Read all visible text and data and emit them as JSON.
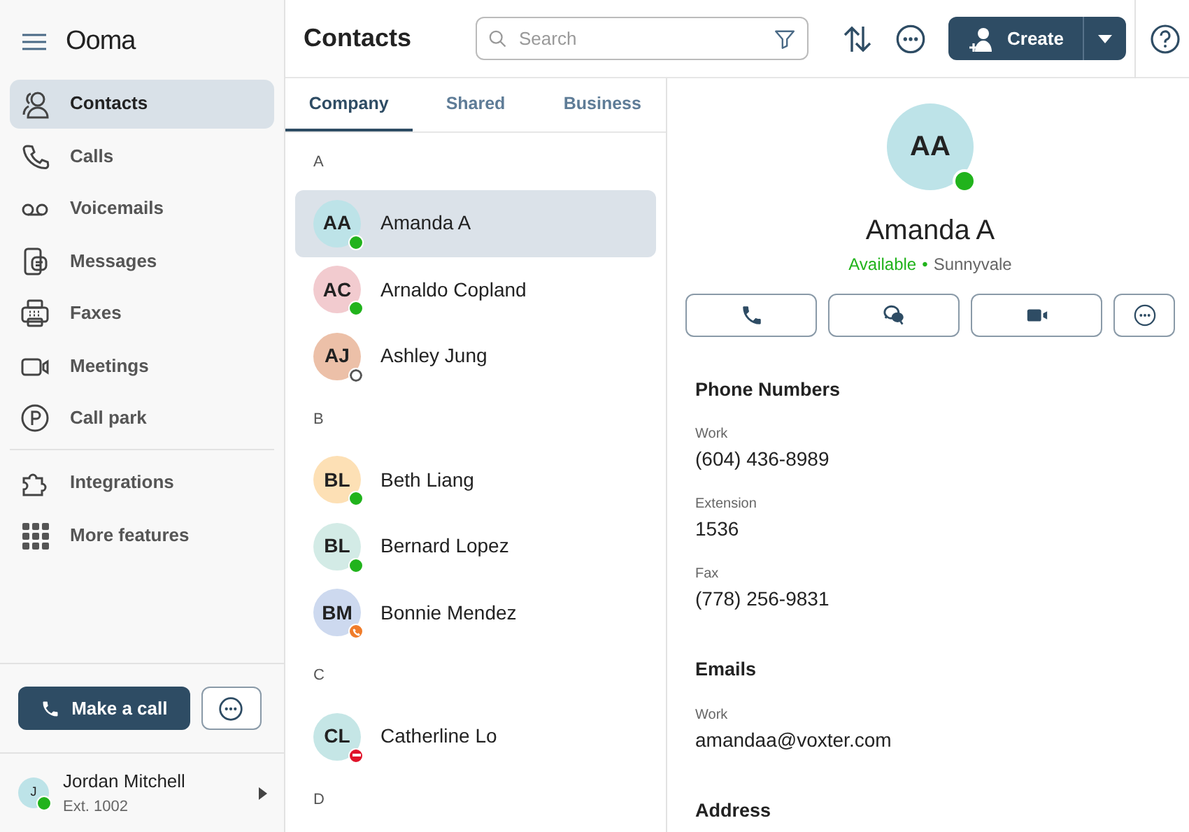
{
  "app": {
    "name": "Ooma"
  },
  "nav": [
    {
      "label": "Contacts",
      "kind": "contacts",
      "selected": true
    },
    {
      "label": "Calls",
      "kind": "phone",
      "selected": false
    },
    {
      "label": "Voicemails",
      "kind": "voicemail",
      "selected": false
    },
    {
      "label": "Messages",
      "kind": "messages",
      "selected": false
    },
    {
      "label": "Faxes",
      "kind": "fax",
      "selected": false
    },
    {
      "label": "Meetings",
      "kind": "video",
      "selected": false
    },
    {
      "label": "Call park",
      "kind": "park",
      "selected": false
    },
    {
      "label": "Integrations",
      "kind": "puzzle",
      "selected": false,
      "divider_before": true
    },
    {
      "label": "More features",
      "kind": "grid",
      "selected": false
    }
  ],
  "make_call_button": "Make a call",
  "user": {
    "initials": "J",
    "name": "Jordan Mitchell",
    "ext": "Ext. 1002",
    "status": {
      "kind": "available"
    }
  },
  "header": {
    "title": "Contacts",
    "search_placeholder": "Search",
    "create_button": "Create"
  },
  "tabs": [
    {
      "label": "Company",
      "selected": true
    },
    {
      "label": "Shared",
      "selected": false
    },
    {
      "label": "Business",
      "selected": false
    }
  ],
  "groups": [
    {
      "letter": "A",
      "contacts": [
        {
          "initials": "AA",
          "name": "Amanda A",
          "color": "#bde3e8",
          "status": {
            "kind": "available"
          },
          "selected": true
        },
        {
          "initials": "AC",
          "name": "Arnaldo Copland",
          "color": "#f2cbcf",
          "status": {
            "kind": "available"
          },
          "selected": false
        },
        {
          "initials": "AJ",
          "name": "Ashley Jung",
          "color": "#ecc0a8",
          "status": {
            "kind": "offline"
          },
          "selected": false
        }
      ]
    },
    {
      "letter": "B",
      "contacts": [
        {
          "initials": "BL",
          "name": "Beth Liang",
          "color": "#fde0b5",
          "status": {
            "kind": "available"
          },
          "selected": false
        },
        {
          "initials": "BL",
          "name": "Bernard Lopez",
          "color": "#d3ebe6",
          "status": {
            "kind": "available"
          },
          "selected": false
        },
        {
          "initials": "BM",
          "name": "Bonnie Mendez",
          "color": "#cdd9ef",
          "status": {
            "kind": "on_call"
          },
          "selected": false
        }
      ]
    },
    {
      "letter": "C",
      "contacts": [
        {
          "initials": "CL",
          "name": "Catherline Lo",
          "color": "#c5e6e6",
          "status": {
            "kind": "dnd"
          },
          "selected": false
        }
      ]
    },
    {
      "letter": "D"
    }
  ],
  "detail": {
    "initials": "AA",
    "status": {
      "kind": "available"
    },
    "name": "Amanda A",
    "availability": "Available",
    "separator": "•",
    "location": "Sunnyvale",
    "sections": [
      {
        "title": "Phone Numbers",
        "fields": [
          {
            "label": "Work",
            "value": "(604) 436-8989"
          },
          {
            "label": "Extension",
            "value": "1536"
          },
          {
            "label": "Fax",
            "value": "(778) 256-9831"
          }
        ]
      },
      {
        "title": "Emails",
        "fields": [
          {
            "label": "Work",
            "value": "amandaa@voxter.com"
          }
        ]
      },
      {
        "title": "Address"
      }
    ]
  }
}
